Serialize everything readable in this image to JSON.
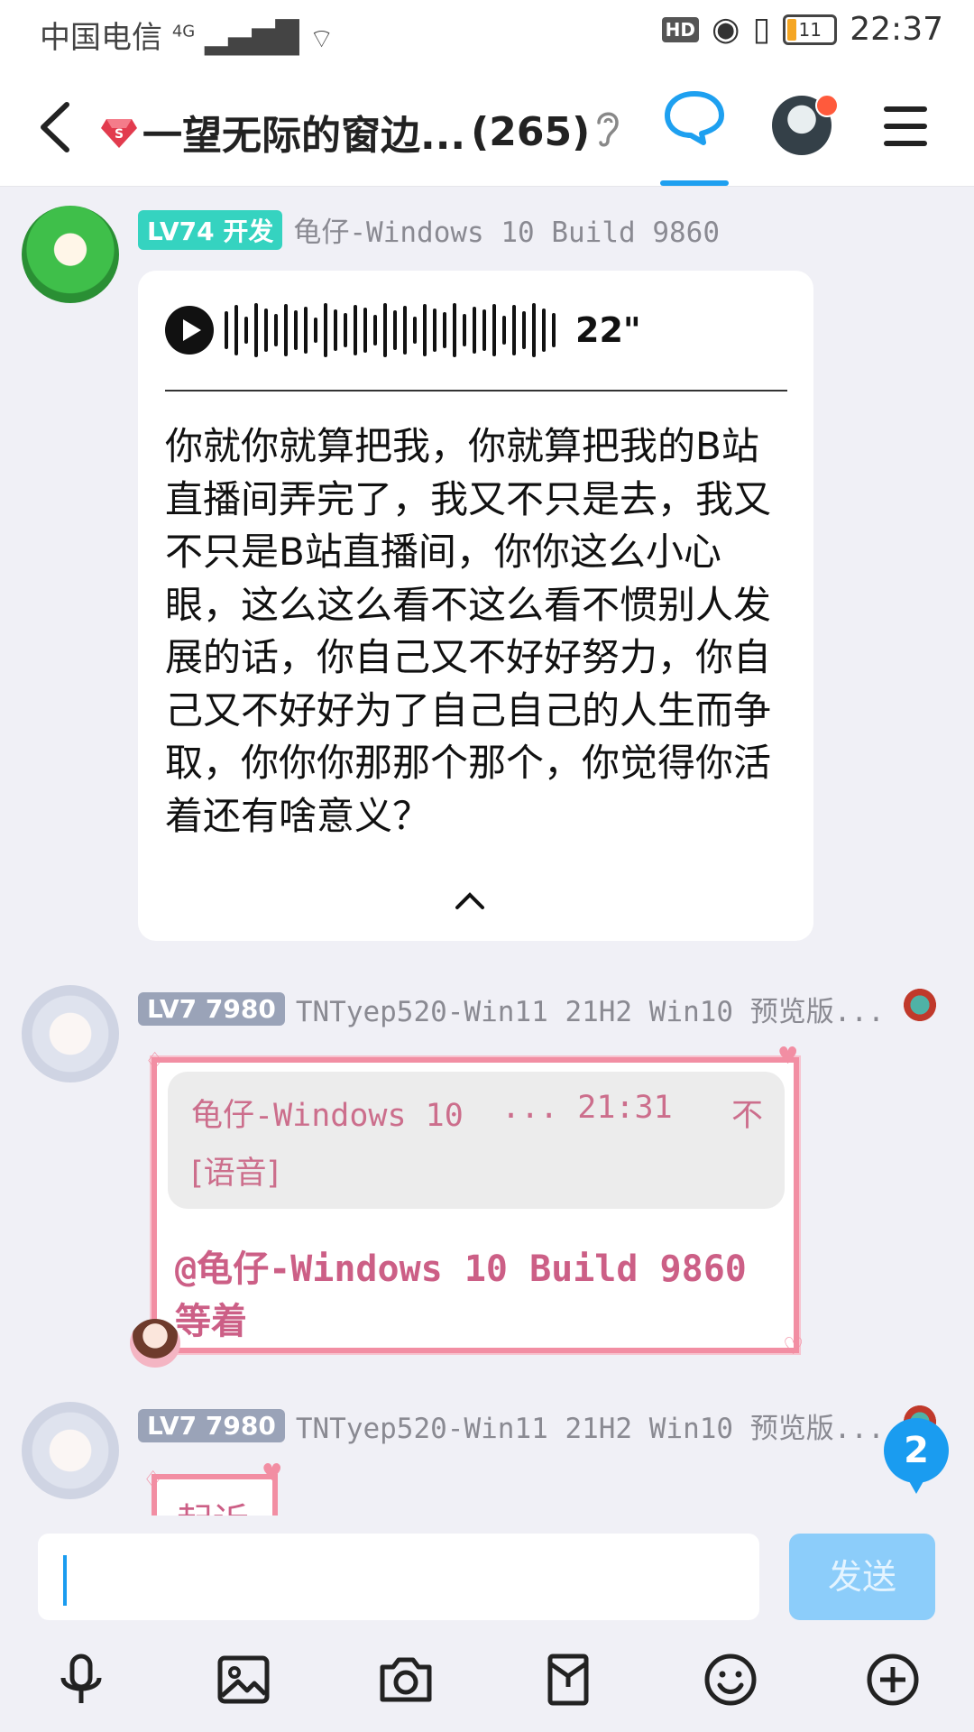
{
  "status_bar": {
    "carrier": "中国电信",
    "network": "4G",
    "battery": "11",
    "time": "22:37",
    "hd": "HD"
  },
  "header": {
    "title_name": "一望无际的窗边...",
    "member_count": "(265)",
    "icons": [
      "back-icon",
      "gem-icon",
      "ear-icon",
      "chat-bubble-icon",
      "avatar",
      "menu-icon"
    ]
  },
  "messages": [
    {
      "level": "LV74",
      "title": "开发",
      "level_color": "#35d3c0",
      "username": "龟仔-Windows 10 Build 9860",
      "voice_duration": "22\"",
      "transcript": "你就你就算把我，你就算把我的B站直播间弄完了，我又不只是去，我又不只是B站直播间，你你这么小心眼，这么这么看不这么看不惯别人发展的话，你自己又不好好努力，你自己又不好好为了自己自己的人生而争取，你你你那那个那个，你觉得你活着还有啥意义？"
    },
    {
      "level": "LV7",
      "title": "7980",
      "level_color": "#9aa3b8",
      "username": "TNTyep520-Win11 21H2 Win10 预览版...",
      "quote_sender": "龟仔-Windows 10",
      "quote_time": "... 21:31",
      "quote_action": "不",
      "quote_content": "[语音]",
      "reply": "@龟仔-Windows 10 Build 9860 等着"
    },
    {
      "level": "LV7",
      "title": "7980",
      "level_color": "#9aa3b8",
      "username": "TNTyep520-Win11 21H2 Win10 预览版...",
      "text": "起诉"
    }
  ],
  "unread_count": "2",
  "input": {
    "value": "",
    "send_label": "发送"
  },
  "toolbar": [
    "microphone-icon",
    "image-icon",
    "camera-icon",
    "red-packet-icon",
    "emoji-icon",
    "plus-icon"
  ],
  "accent_color": "#1ea0f0"
}
